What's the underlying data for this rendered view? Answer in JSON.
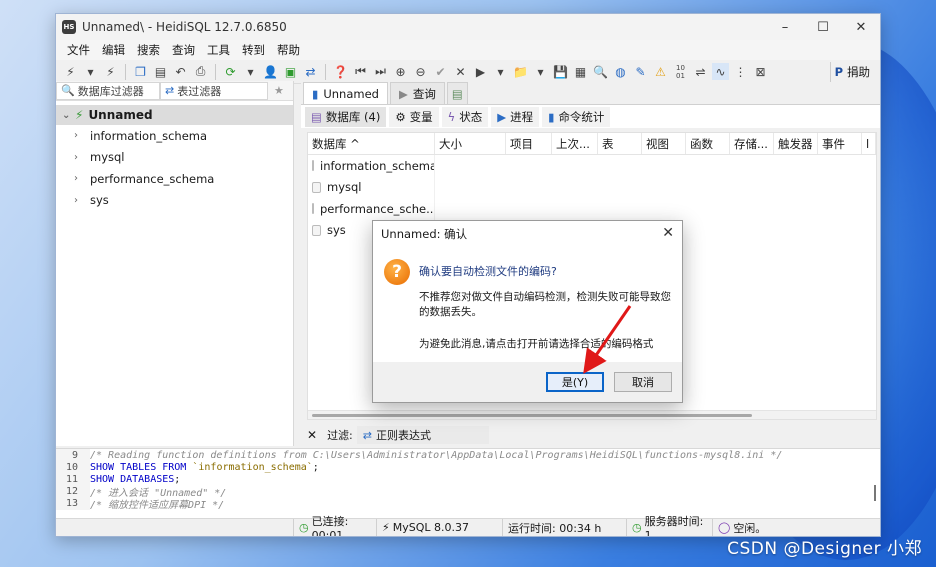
{
  "window": {
    "title": "Unnamed\\ - HeidiSQL 12.7.0.6850",
    "controls": [
      "–",
      "☐",
      "✕"
    ]
  },
  "menu": [
    "文件",
    "编辑",
    "搜索",
    "查询",
    "工具",
    "转到",
    "帮助"
  ],
  "toolbar": {
    "donate_label": "捐助"
  },
  "left_panel": {
    "db_filter_label": "数据库过滤器",
    "table_filter_label": "表过滤器",
    "root_label": "Unnamed",
    "databases": [
      "information_schema",
      "mysql",
      "performance_schema",
      "sys"
    ]
  },
  "tabs": {
    "session_tab": "Unnamed",
    "query_tab": "查询",
    "sub_tabs": [
      "数据库 (4)",
      "变量",
      "状态",
      "进程",
      "命令统计"
    ]
  },
  "grid": {
    "headers": [
      "数据库 ^",
      "大小",
      "项目",
      "上次...",
      "表",
      "视图",
      "函数",
      "存储...",
      "触发器",
      "事件",
      "l"
    ],
    "rows": [
      "information_schema",
      "mysql",
      "performance_sche...",
      "sys"
    ]
  },
  "filter_bar": {
    "label": "过滤:",
    "input_label": "正则表达式"
  },
  "sql_log": {
    "lines": [
      {
        "no": "9",
        "text": "/* Reading function definitions from C:\\Users\\Administrator\\AppData\\Local\\Programs\\HeidiSQL\\functions-mysql8.ini */"
      },
      {
        "no": "10",
        "kw": "SHOW TABLES FROM ",
        "str": "`information_schema`",
        "rest": ";"
      },
      {
        "no": "11",
        "kw": "SHOW DATABASES",
        "rest": ";"
      },
      {
        "no": "12",
        "text": "/* 进入会话 \"Unnamed\" */"
      },
      {
        "no": "13",
        "text": "/* 缩放控件适应屏幕DPI */"
      }
    ]
  },
  "status_bar": {
    "connected": "已连接: 00:01",
    "server_version": "MySQL 8.0.37",
    "uptime": "运行时间: 00:34 h",
    "server_time": "服务器时间: 1",
    "idle": "空闲。"
  },
  "dialog": {
    "title": "Unnamed: 确认",
    "close": "✕",
    "question": "确认要自动检测文件的编码?",
    "detail": "不推荐您对做文件自动编码检测，检测失败可能导致您的数据丢失。",
    "hint": "为避免此消息,请点击打开前请选择合适的编码格式",
    "yes_button": "是(Y)",
    "cancel_button": "取消"
  },
  "watermark": "CSDN @Designer 小郑",
  "colors": {
    "annotation_arrow": "#e01818",
    "default_button_border": "#0a64c8",
    "question_icon": "#e86b00"
  }
}
